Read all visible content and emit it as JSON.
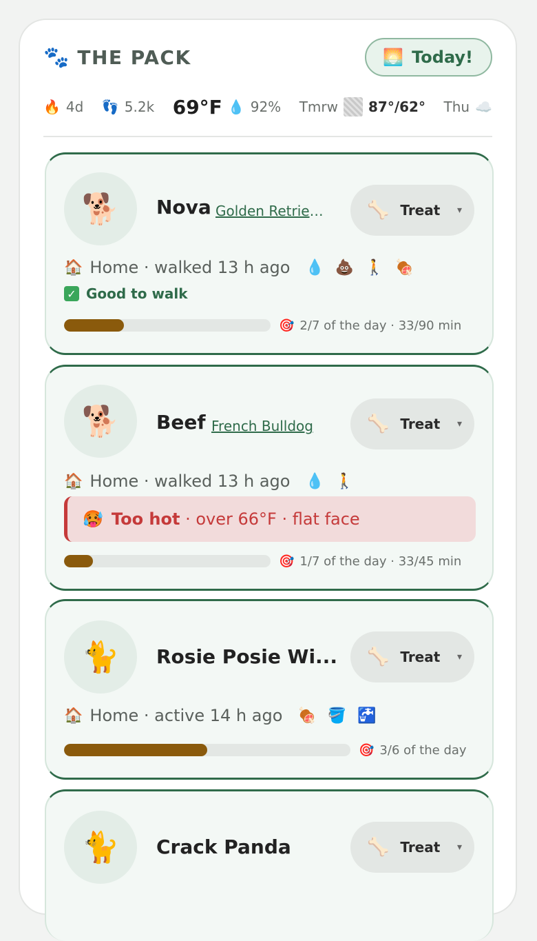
{
  "header": {
    "brand_icon": "🐾",
    "title": "THE PACK",
    "today_button": {
      "icon": "🌅",
      "label": "Today!"
    }
  },
  "stats": {
    "streak": {
      "icon": "🔥",
      "value": "4d"
    },
    "steps": {
      "icon": "👣",
      "value": "5.2k"
    },
    "temperature": "69°F",
    "humidity": {
      "icon": "💧",
      "value": "92%"
    },
    "tomorrow": {
      "label": "Tmrw",
      "icon": "haze-icon",
      "range": "87°/62°"
    },
    "thursday": {
      "label": "Thu",
      "icon": "☁️"
    }
  },
  "pets": [
    {
      "avatar": "🐕",
      "name": "Nova",
      "breed": "Golden Retriever",
      "treat": {
        "icon": "🦴",
        "label": "Treat",
        "caret": "▾"
      },
      "location_icon": "🏠",
      "status": "Home · walked 13 h ago",
      "activity_icons": [
        "💧",
        "💩",
        "🚶",
        "🍖"
      ],
      "note": {
        "type": "good",
        "icon": "✓",
        "text": "Good to walk"
      },
      "progress": {
        "fraction": 0.29,
        "icon": "🎯",
        "text": "2/7 of the day · 33/90 min"
      }
    },
    {
      "avatar": "🐕",
      "name": "Beef",
      "breed": "French Bulldog",
      "treat": {
        "icon": "🦴",
        "label": "Treat",
        "caret": "▾"
      },
      "location_icon": "🏠",
      "status": "Home · walked 13 h ago",
      "activity_icons": [
        "💧",
        "🚶"
      ],
      "warning": {
        "icon": "🥵",
        "strong": "Too hot",
        "detail": " · over 66°F · flat face"
      },
      "progress": {
        "fraction": 0.14,
        "icon": "🎯",
        "text": "1/7 of the day · 33/45 min"
      }
    },
    {
      "avatar": "🐈",
      "name": "Rosie Posie Wi...",
      "treat": {
        "icon": "🦴",
        "label": "Treat",
        "caret": "▾"
      },
      "location_icon": "🏠",
      "status": "Home · active 14 h ago",
      "activity_icons": [
        "🍖",
        "🪣",
        "🚰"
      ],
      "progress": {
        "fraction": 0.5,
        "icon": "🎯",
        "text": "3/6 of the day"
      }
    },
    {
      "avatar": "🐈",
      "name": "Crack Panda",
      "treat": {
        "icon": "🦴",
        "label": "Treat",
        "caret": "▾"
      }
    }
  ],
  "colors": {
    "accent": "#2f6b4a",
    "progress_fill": "#8a5a0c",
    "warning": "#c53a3a"
  }
}
